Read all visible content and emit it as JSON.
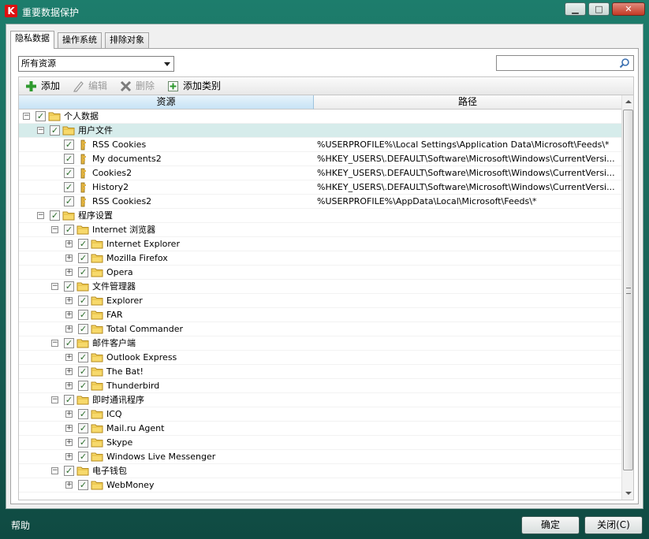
{
  "window": {
    "title": "重要数据保护",
    "app_icon": "K",
    "btn_min": "▁",
    "btn_max": "□",
    "btn_close": "✕"
  },
  "tabs": [
    {
      "label": "隐私数据",
      "active": true
    },
    {
      "label": "操作系统",
      "active": false
    },
    {
      "label": "排除对象",
      "active": false
    }
  ],
  "filter": {
    "selected": "所有资源"
  },
  "search": {
    "placeholder": "",
    "icon": "search-icon"
  },
  "toolbar": {
    "add": "添加",
    "edit": "编辑",
    "delete": "删除",
    "add_category": "添加类别"
  },
  "columns": {
    "resource": "资源",
    "path": "路径"
  },
  "tree": [
    {
      "level": 0,
      "expand": "−",
      "label": "个人数据",
      "icon": "folder",
      "path": ""
    },
    {
      "level": 1,
      "expand": "−",
      "label": "用户文件",
      "icon": "folder",
      "path": "",
      "selected": true
    },
    {
      "level": 2,
      "expand": "",
      "label": "RSS Cookies",
      "icon": "key",
      "path": "%USERPROFILE%\\Local Settings\\Application Data\\Microsoft\\Feeds\\*"
    },
    {
      "level": 2,
      "expand": "",
      "label": "My documents2",
      "icon": "key",
      "path": "%HKEY_USERS\\.DEFAULT\\Software\\Microsoft\\Windows\\CurrentVersi..."
    },
    {
      "level": 2,
      "expand": "",
      "label": "Cookies2",
      "icon": "key",
      "path": "%HKEY_USERS\\.DEFAULT\\Software\\Microsoft\\Windows\\CurrentVersi..."
    },
    {
      "level": 2,
      "expand": "",
      "label": "History2",
      "icon": "key",
      "path": "%HKEY_USERS\\.DEFAULT\\Software\\Microsoft\\Windows\\CurrentVersi..."
    },
    {
      "level": 2,
      "expand": "",
      "label": "RSS Cookies2",
      "icon": "key",
      "path": "%USERPROFILE%\\AppData\\Local\\Microsoft\\Feeds\\*"
    },
    {
      "level": 1,
      "expand": "−",
      "label": "程序设置",
      "icon": "folder",
      "path": ""
    },
    {
      "level": 2,
      "expand": "−",
      "label": "Internet 浏览器",
      "icon": "folder",
      "path": ""
    },
    {
      "level": 3,
      "expand": "+",
      "label": "Internet Explorer",
      "icon": "folder",
      "path": ""
    },
    {
      "level": 3,
      "expand": "+",
      "label": "Mozilla Firefox",
      "icon": "folder",
      "path": ""
    },
    {
      "level": 3,
      "expand": "+",
      "label": "Opera",
      "icon": "folder",
      "path": ""
    },
    {
      "level": 2,
      "expand": "−",
      "label": "文件管理器",
      "icon": "folder",
      "path": ""
    },
    {
      "level": 3,
      "expand": "+",
      "label": "Explorer",
      "icon": "folder",
      "path": ""
    },
    {
      "level": 3,
      "expand": "+",
      "label": "FAR",
      "icon": "folder",
      "path": ""
    },
    {
      "level": 3,
      "expand": "+",
      "label": "Total Commander",
      "icon": "folder",
      "path": ""
    },
    {
      "level": 2,
      "expand": "−",
      "label": "邮件客户端",
      "icon": "folder",
      "path": ""
    },
    {
      "level": 3,
      "expand": "+",
      "label": "Outlook Express",
      "icon": "folder",
      "path": ""
    },
    {
      "level": 3,
      "expand": "+",
      "label": "The Bat!",
      "icon": "folder",
      "path": ""
    },
    {
      "level": 3,
      "expand": "+",
      "label": "Thunderbird",
      "icon": "folder",
      "path": ""
    },
    {
      "level": 2,
      "expand": "−",
      "label": "即时通讯程序",
      "icon": "folder",
      "path": ""
    },
    {
      "level": 3,
      "expand": "+",
      "label": "ICQ",
      "icon": "folder",
      "path": ""
    },
    {
      "level": 3,
      "expand": "+",
      "label": "Mail.ru Agent",
      "icon": "folder",
      "path": ""
    },
    {
      "level": 3,
      "expand": "+",
      "label": "Skype",
      "icon": "folder",
      "path": ""
    },
    {
      "level": 3,
      "expand": "+",
      "label": "Windows Live Messenger",
      "icon": "folder",
      "path": ""
    },
    {
      "level": 2,
      "expand": "−",
      "label": "电子钱包",
      "icon": "folder",
      "path": ""
    },
    {
      "level": 3,
      "expand": "+",
      "label": "WebMoney",
      "icon": "folder",
      "path": ""
    }
  ],
  "footer": {
    "help": "帮助",
    "ok": "确定",
    "close": "关闭(C)"
  },
  "colors": {
    "frame": "#1a6b5d",
    "selection": "#d6eceb",
    "header_active": "#c7e3f5"
  }
}
